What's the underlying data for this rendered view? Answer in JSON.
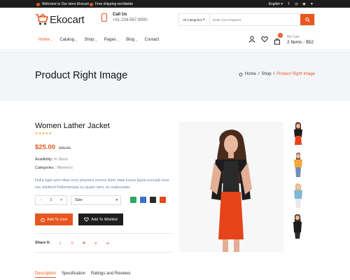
{
  "topbar": {
    "welcome": "Welcome to Our store Ekocart",
    "shipping": "Free shipping worldwide",
    "language": "English"
  },
  "header": {
    "logo_text": "Ekocart",
    "contact_title": "Call Us",
    "contact_phone": "+91-234-567-8900",
    "search_category": "All Categories",
    "search_placeholder": "Enter Your Keyword",
    "cart_label": "My Cart",
    "cart_summary": "2 Items - $52",
    "cart_count": "2"
  },
  "nav": {
    "items": [
      {
        "label": "Home"
      },
      {
        "label": "Catalog"
      },
      {
        "label": "Shop"
      },
      {
        "label": "Pages"
      },
      {
        "label": "Blog"
      },
      {
        "label": "Contact"
      }
    ]
  },
  "banner": {
    "title": "Product Right Image",
    "crumbs": [
      "Home",
      "/",
      "Shop",
      "/",
      "Product Right Image"
    ]
  },
  "product": {
    "name": "Women Lather Jacket",
    "stars": "★★★★★",
    "price": "$25.00",
    "old_price": "$35.00",
    "availability_label": "Availibility:",
    "availability_value": "In Stock",
    "categories_label": "Categories :",
    "categories_value": "Women's",
    "description": "Nulla eget sem vitae eros pharetra viverra Nam vitae luctus ligula suscipit risus nec eleifend Pellentesque eu quam sem, ac malesuada",
    "qty_minus": "-",
    "qty_value": "1",
    "qty_plus": "+",
    "size_label": "Size",
    "swatches": [
      "#2ea763",
      "#3b6fd1",
      "#2b2b2b",
      "#e8461f"
    ],
    "add_to_cart": "Add To Cart",
    "add_to_wishlist": "Add To Wishlist",
    "share_label": "Share It:",
    "share_icons": [
      "f",
      "◎",
      "◉",
      "♥",
      "in"
    ]
  },
  "tabs": {
    "items": [
      "Description",
      "Specification",
      "Ratings and Reviews"
    ]
  },
  "colors": {
    "accent": "#e8561f",
    "dark": "#1e1e1e",
    "banner": "#f3f6f9"
  }
}
